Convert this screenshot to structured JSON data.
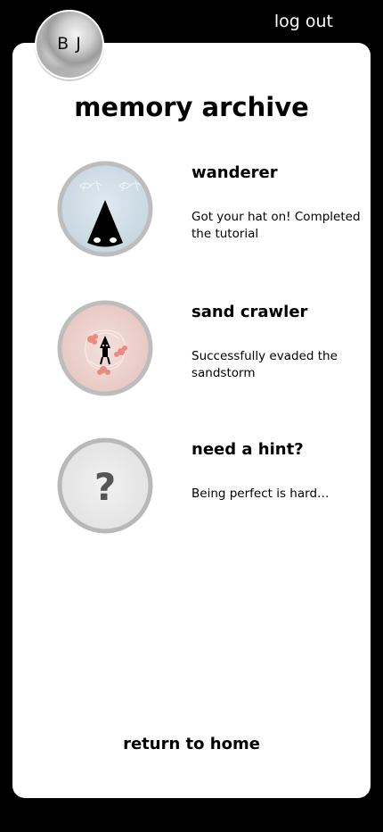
{
  "header": {
    "avatar_initials": "B J",
    "logout_label": "log out"
  },
  "page": {
    "title": "memory archive",
    "return_label": "return to home"
  },
  "achievements": [
    {
      "name": "wanderer",
      "description": "Got your hat on! Completed the tutorial",
      "icon": "wanderer-icon"
    },
    {
      "name": "sand crawler",
      "description": "Successfully evaded the sandstorm",
      "icon": "sand-crawler-icon"
    },
    {
      "name": "need a hint?",
      "description": "Being perfect is hard…",
      "icon": "question-mark-icon"
    }
  ],
  "colors": {
    "background": "#000000",
    "card": "#ffffff",
    "badge_ring": "#b8b8b8",
    "wanderer_fill": "#cfdde6",
    "sand_crawler_fill": "#ecd0cb",
    "hint_fill": "#e6e6e6"
  }
}
